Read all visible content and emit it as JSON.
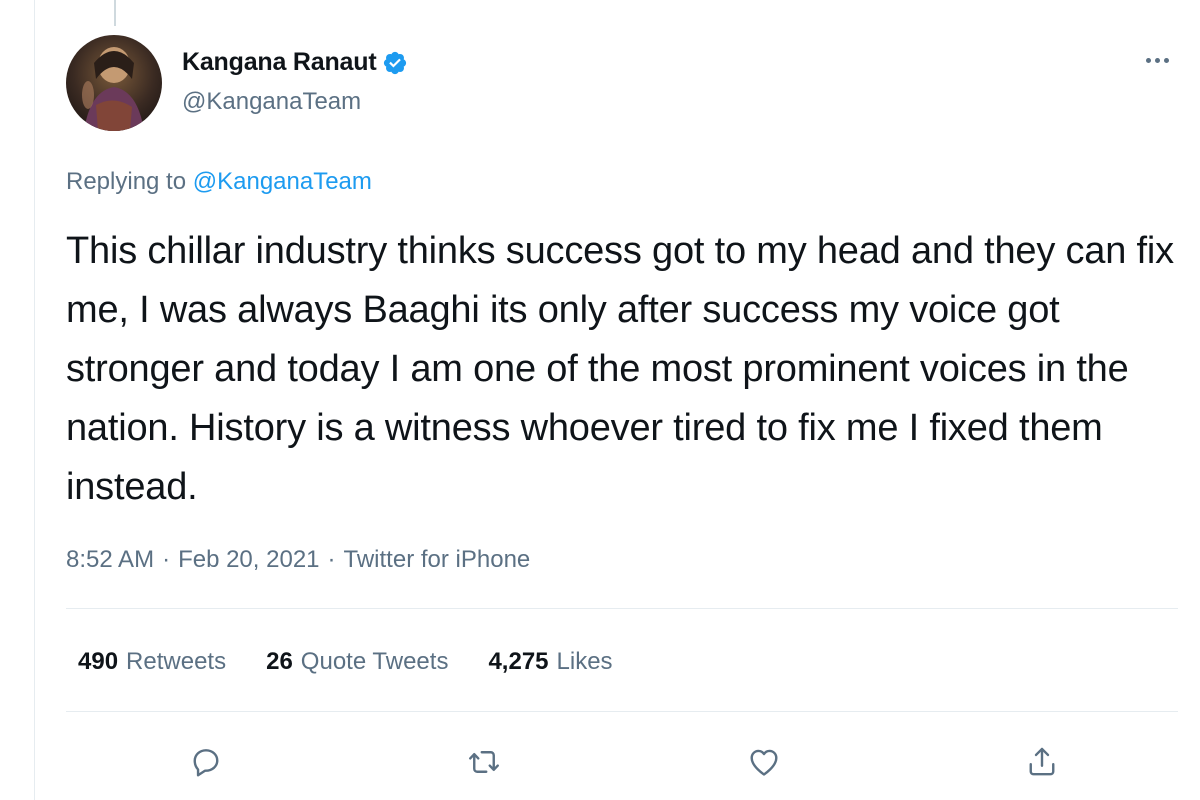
{
  "author": {
    "display_name": "Kangana Ranaut",
    "handle": "@KanganaTeam",
    "verified": true
  },
  "reply": {
    "prefix": "Replying to",
    "to_handle": "@KanganaTeam"
  },
  "tweet": {
    "text": "This chillar industry thinks success got to my head and they can fix me, I was always Baaghi its only after success my voice got stronger and today I am one of the most prominent voices in the nation. History is a witness whoever tired to fix me I fixed them instead."
  },
  "meta": {
    "time": "8:52 AM",
    "separator1": "·",
    "date": "Feb 20, 2021",
    "separator2": "·",
    "source": "Twitter for iPhone"
  },
  "stats": {
    "retweets_count": "490",
    "retweets_label": "Retweets",
    "quotes_count": "26",
    "quotes_label": "Quote Tweets",
    "likes_count": "4,275",
    "likes_label": "Likes"
  },
  "colors": {
    "accent": "#1d9bf0",
    "text_primary": "#0f1419",
    "text_secondary": "#5b7083",
    "divider": "#e6ecf0"
  },
  "icons": {
    "verified": "verified-badge-icon",
    "more": "more-horizontal-icon",
    "reply": "reply-icon",
    "retweet": "retweet-icon",
    "like": "heart-icon",
    "share": "share-icon"
  }
}
